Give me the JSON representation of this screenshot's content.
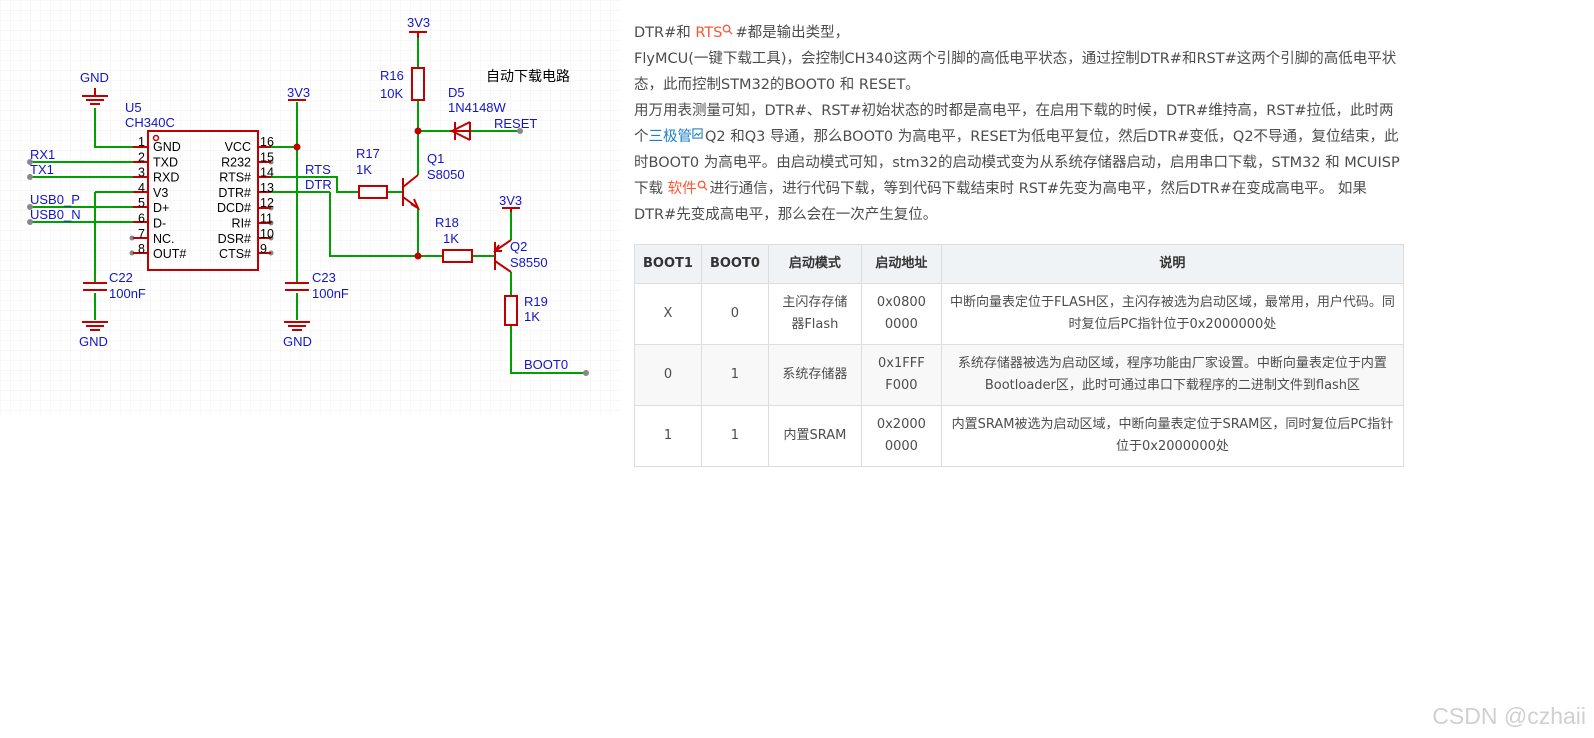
{
  "schematic": {
    "title": "自动下载电路",
    "u5": {
      "ref": "U5",
      "part": "CH340C"
    },
    "pins_left": [
      {
        "num": "1",
        "name": "GND"
      },
      {
        "num": "2",
        "name": "TXD"
      },
      {
        "num": "3",
        "name": "RXD"
      },
      {
        "num": "4",
        "name": "V3"
      },
      {
        "num": "5",
        "name": "D+"
      },
      {
        "num": "6",
        "name": "D-"
      },
      {
        "num": "7",
        "name": "NC."
      },
      {
        "num": "8",
        "name": "OUT#"
      }
    ],
    "pins_right": [
      {
        "num": "16",
        "name": "VCC"
      },
      {
        "num": "15",
        "name": "R232"
      },
      {
        "num": "14",
        "name": "RTS#"
      },
      {
        "num": "13",
        "name": "DTR#"
      },
      {
        "num": "12",
        "name": "DCD#"
      },
      {
        "num": "11",
        "name": "RI#"
      },
      {
        "num": "10",
        "name": "DSR#"
      },
      {
        "num": "9",
        "name": "CTS#"
      }
    ],
    "nets": {
      "rx1": "RX1",
      "tx1": "TX1",
      "usb_p": "USB0_P",
      "usb_n": "USB0_N",
      "rts": "RTS",
      "dtr": "DTR",
      "reset": "RESET",
      "boot0": "BOOT0",
      "gnd": "GND",
      "v33": "3V3"
    },
    "r16": {
      "ref": "R16",
      "val": "10K"
    },
    "r17": {
      "ref": "R17",
      "val": "1K"
    },
    "r18": {
      "ref": "R18",
      "val": "1K"
    },
    "r19": {
      "ref": "R19",
      "val": "1K"
    },
    "d5": {
      "ref": "D5",
      "val": "1N4148W"
    },
    "q1": {
      "ref": "Q1",
      "val": "S8050"
    },
    "q2": {
      "ref": "Q2",
      "val": "S8550"
    },
    "c22": {
      "ref": "C22",
      "val": "100nF"
    },
    "c23": {
      "ref": "C23",
      "val": "100nF"
    }
  },
  "article": {
    "p1": {
      "pre": "DTR#和 ",
      "kw": "RTS",
      "post": "#都是输出类型，"
    },
    "p2": "FlyMCU(一键下载工具)，会控制CH340这两个引脚的高低电平状态，通过控制DTR#和RST#这两个引脚的高低电平状态，此而控制STM32的BOOT0 和 RESET。",
    "p3": {
      "a": "用万用表测量可知，DTR#、RST#初始状态的时都是高电平，在启用下载的时候，DTR#维持高，RST#拉低，此时两个",
      "kw1": "三极管",
      "b": "Q2 和Q3 导通，那么BOOT0 为高电平，RESET为低电平复位，然后DTR#变低，Q2不导通，复位结束，此时BOOT0 为高电平。由启动模式可知，stm32的启动模式变为从系统存储器启动，启用串口下载，STM32 和 MCUISP下载 ",
      "kw2": "软件",
      "c": "进行通信，进行代码下载，等到代码下载结束时 RST#先变为高电平，然后DTR#在变成高电平。 如果DTR#先变成高电平，那么会在一次产生复位。"
    }
  },
  "table": {
    "headers": [
      "BOOT1",
      "BOOT0",
      "启动模式",
      "启动地址",
      "说明"
    ],
    "rows": [
      [
        "X",
        "0",
        "主闪存存储器Flash",
        "0x0800 0000",
        "中断向量表定位于FLASH区，主闪存被选为启动区域，最常用，用户代码。同时复位后PC指针位于0x2000000处"
      ],
      [
        "0",
        "1",
        "系统存储器",
        "0x1FFF F000",
        "系统存储器被选为启动区域，程序功能由厂家设置。中断向量表定位于内置Bootloader区，此时可通过串口下载程序的二进制文件到flash区"
      ],
      [
        "1",
        "1",
        "内置SRAM",
        "0x2000 0000",
        "内置SRAM被选为启动区域，中断向量表定位于SRAM区，同时复位后PC指针位于0x2000000处"
      ]
    ]
  },
  "watermark": "CSDN @czhaii",
  "colors": {
    "wire": "#00a000",
    "part": "#c00000",
    "label": "#1515c8",
    "keyword_red": "#fc5531",
    "keyword_blue": "#1c7ec8"
  }
}
